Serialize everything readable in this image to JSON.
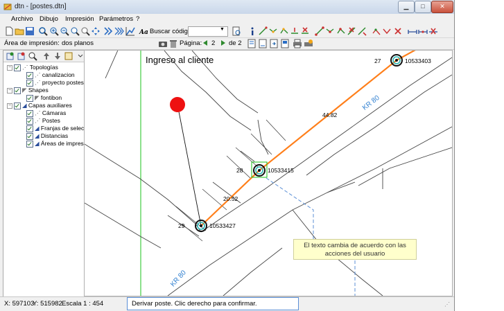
{
  "window": {
    "title": "dtn - [postes.dtn]"
  },
  "menu": {
    "items": [
      "Archivo",
      "Dibujo",
      "Impresión",
      "Parámetros",
      "?"
    ]
  },
  "toolbar": {
    "search_label": "Buscar código:",
    "search_value": ""
  },
  "print_bar": {
    "area_label": "Área de impresión:",
    "area_value": "dos planos",
    "page_label": "Página:",
    "page_current": "2",
    "page_of": "de 2"
  },
  "layers": {
    "groups": [
      {
        "label": "Topologías",
        "children": [
          "canalizacion",
          "proyecto postes"
        ]
      },
      {
        "label": "Shapes",
        "children": [
          "fontibon"
        ]
      },
      {
        "label": "Capas auxiliares",
        "children": [
          "Cámaras",
          "Postes",
          "Franjas de selecció",
          "Distancias",
          "Áreas de impresión"
        ]
      }
    ]
  },
  "map": {
    "title": "Ingreso al cliente",
    "poles": [
      {
        "number": "27",
        "code": "10533403"
      },
      {
        "number": "28",
        "code": "10533415"
      },
      {
        "number": "29",
        "code": "10533427"
      }
    ],
    "distances": [
      "44.82",
      "20.52"
    ],
    "street_labels": [
      "KR 80",
      "KR 80"
    ]
  },
  "callout": {
    "line1": "El texto cambia de acuerdo con las",
    "line2": "acciones del usuario"
  },
  "status": {
    "x": "X: 597103",
    "y": "Y: 515982",
    "scale": "Escala  1 : 454",
    "message": "Derivar poste. Clic derecho para confirmar."
  },
  "colors": {
    "route": "#ff7f1a",
    "street_label": "#2f7fd0",
    "selection": "#19c219",
    "red_marker": "#ee1111",
    "callout_bg": "#ffffcc",
    "dashed_connector": "#5b8fd6"
  },
  "icons": [
    "app-icon",
    "new-icon",
    "open-icon",
    "save-icon",
    "zoom-in-icon",
    "zoom-out-icon",
    "zoom-window-icon",
    "pan-icon",
    "font-icon",
    "print-preview-icon",
    "info-icon",
    "pole-icon",
    "camera-icon",
    "delete-icon",
    "page-first-icon",
    "page-prev-icon",
    "page-next-icon",
    "page-last-icon",
    "print-icon"
  ]
}
